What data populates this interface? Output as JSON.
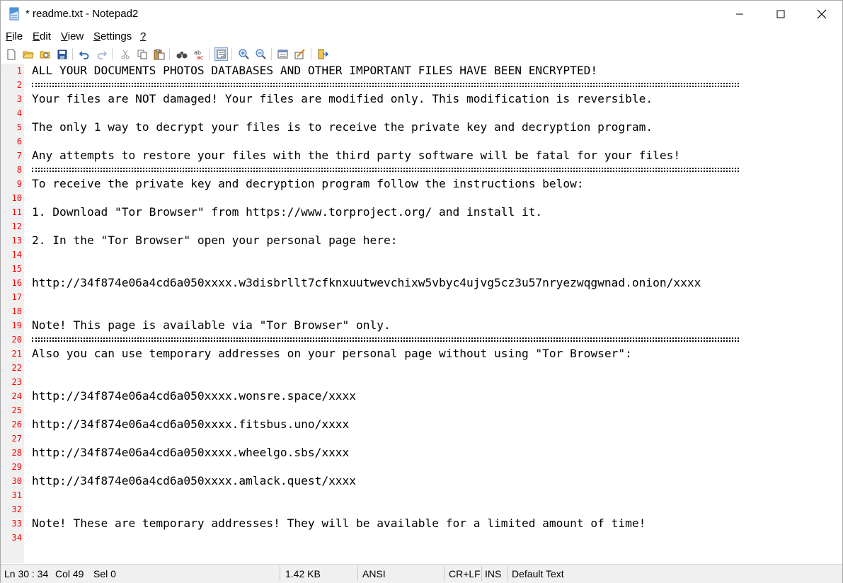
{
  "window": {
    "title": "* readme.txt - Notepad2"
  },
  "menu": [
    {
      "label": "File",
      "key": "F",
      "rest": "ile"
    },
    {
      "label": "Edit",
      "key": "E",
      "rest": "dit"
    },
    {
      "label": "View",
      "key": "V",
      "rest": "iew"
    },
    {
      "label": "Settings",
      "key": "S",
      "rest": "ettings"
    },
    {
      "label": "?",
      "key": "?",
      "rest": ""
    }
  ],
  "toolbar": [
    "new-file-icon",
    "open-folder-icon",
    "browse-icon",
    "save-icon",
    "undo-icon",
    "redo-icon",
    "cut-icon",
    "copy-icon",
    "paste-icon",
    "find-icon",
    "replace-icon",
    "word-wrap-icon",
    "zoom-in-icon",
    "zoom-out-icon",
    "scheme-icon",
    "customize-icon",
    "exit-icon"
  ],
  "editor": {
    "lines": [
      {
        "n": "1",
        "text": "ALL YOUR DOCUMENTS PHOTOS DATABASES AND OTHER IMPORTANT FILES HAVE BEEN ENCRYPTED!"
      },
      {
        "n": "2",
        "text": "",
        "separator": true
      },
      {
        "n": "3",
        "text": "Your files are NOT damaged! Your files are modified only. This modification is reversible."
      },
      {
        "n": "4",
        "text": ""
      },
      {
        "n": "5",
        "text": "The only 1 way to decrypt your files is to receive the private key and decryption program."
      },
      {
        "n": "6",
        "text": ""
      },
      {
        "n": "7",
        "text": "Any attempts to restore your files with the third party software will be fatal for your files!"
      },
      {
        "n": "8",
        "text": "",
        "separator": true
      },
      {
        "n": "9",
        "text": "To receive the private key and decryption program follow the instructions below:"
      },
      {
        "n": "10",
        "text": ""
      },
      {
        "n": "11",
        "text": "1. Download \"Tor Browser\" from https://www.torproject.org/ and install it."
      },
      {
        "n": "12",
        "text": ""
      },
      {
        "n": "13",
        "text": "2. In the \"Tor Browser\" open your personal page here:"
      },
      {
        "n": "14",
        "text": ""
      },
      {
        "n": "15",
        "text": ""
      },
      {
        "n": "16",
        "text": "http://34f874e06a4cd6a050xxxx.w3disbrllt7cfknxuutwevchixw5vbyc4ujvg5cz3u57nryezwqgwnad.onion/xxxx"
      },
      {
        "n": "17",
        "text": ""
      },
      {
        "n": "18",
        "text": ""
      },
      {
        "n": "19",
        "text": "Note! This page is available via \"Tor Browser\" only."
      },
      {
        "n": "20",
        "text": "",
        "separator": true
      },
      {
        "n": "21",
        "text": "Also you can use temporary addresses on your personal page without using \"Tor Browser\":"
      },
      {
        "n": "22",
        "text": ""
      },
      {
        "n": "23",
        "text": ""
      },
      {
        "n": "24",
        "text": "http://34f874e06a4cd6a050xxxx.wonsre.space/xxxx"
      },
      {
        "n": "25",
        "text": ""
      },
      {
        "n": "26",
        "text": "http://34f874e06a4cd6a050xxxx.fitsbus.uno/xxxx"
      },
      {
        "n": "27",
        "text": ""
      },
      {
        "n": "28",
        "text": "http://34f874e06a4cd6a050xxxx.wheelgo.sbs/xxxx"
      },
      {
        "n": "29",
        "text": ""
      },
      {
        "n": "30",
        "text": "http://34f874e06a4cd6a050xxxx.amlack.quest/xxxx"
      },
      {
        "n": "31",
        "text": ""
      },
      {
        "n": "32",
        "text": ""
      },
      {
        "n": "33",
        "text": "Note! These are temporary addresses! They will be available for a limited amount of time!"
      },
      {
        "n": "34",
        "text": ""
      }
    ]
  },
  "status": {
    "position": "Ln 30 : 34",
    "column": "Col 49",
    "selection": "Sel 0",
    "size": "1.42 KB",
    "encoding": "ANSI",
    "line_endings": "CR+LF",
    "mode": "INS",
    "scheme": "Default Text"
  },
  "colors": {
    "line_number": "#ff0000",
    "gutter_bg": "#f0f0f0",
    "status_bg": "#f0f0f0"
  }
}
